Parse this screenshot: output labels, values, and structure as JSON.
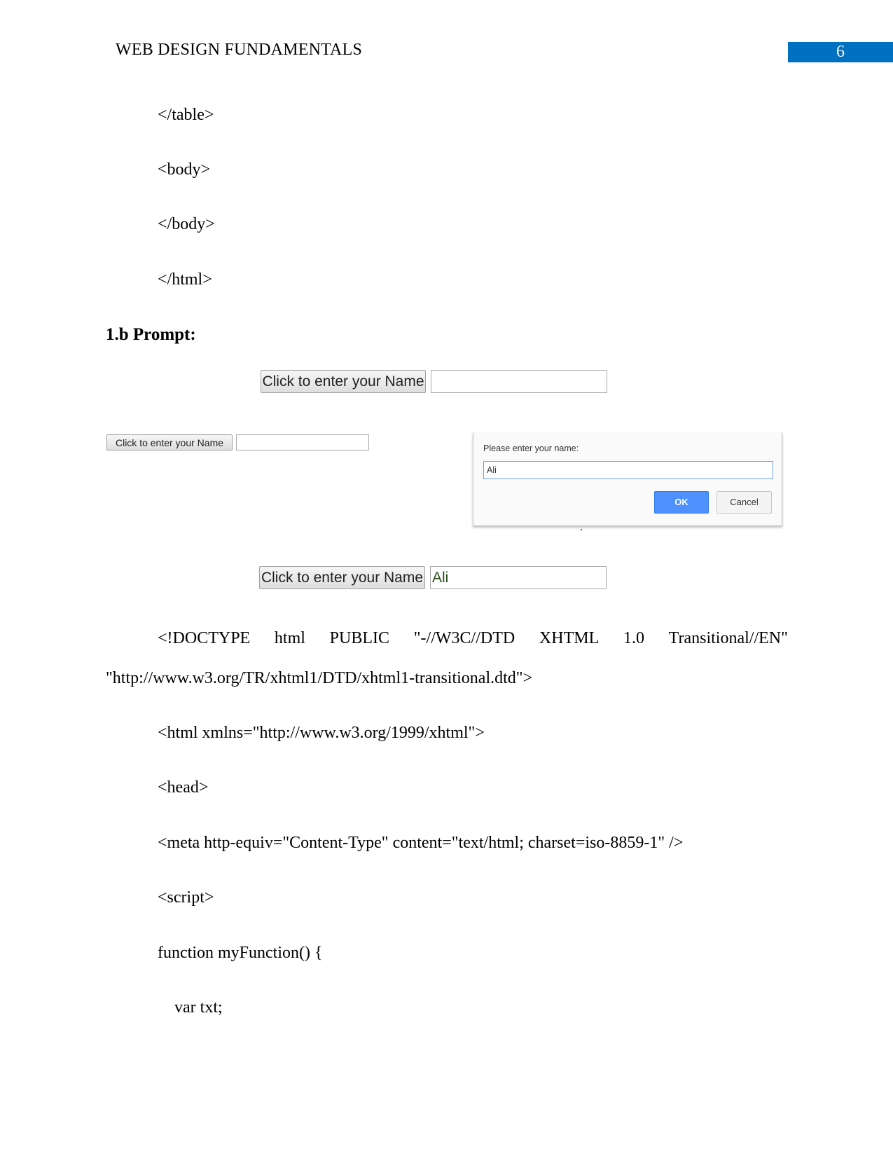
{
  "header": {
    "running_head": "WEB DESIGN FUNDAMENTALS",
    "page_number": "6",
    "accent_color": "#0070c0"
  },
  "code_top": [
    "</table>",
    "<body>",
    "</body>",
    "</html>"
  ],
  "section_heading": "1.b Prompt:",
  "screenshots": {
    "before": {
      "button_label": "Click to enter your Name",
      "input_value": ""
    },
    "during": {
      "button_label": "Click to enter your Name",
      "input_value": "",
      "dialog": {
        "message": "Please enter your name:",
        "input_value": "Ali",
        "ok_label": "OK",
        "cancel_label": "Cancel"
      }
    },
    "after": {
      "button_label": "Click to enter your Name",
      "input_value": "Ali"
    }
  },
  "code_bottom": {
    "doctype_words": [
      "<!DOCTYPE",
      "html",
      "PUBLIC",
      "\"-//W3C//DTD",
      "XHTML",
      "1.0",
      "Transitional//EN\""
    ],
    "doctype_continuation": "\"http://www.w3.org/TR/xhtml1/DTD/xhtml1-transitional.dtd\">",
    "lines": [
      "<html xmlns=\"http://www.w3.org/1999/xhtml\">",
      "<head>",
      "<meta http-equiv=\"Content-Type\" content=\"text/html; charset=iso-8859-1\" />",
      "<script>",
      "function myFunction() {",
      "    var txt;"
    ]
  }
}
